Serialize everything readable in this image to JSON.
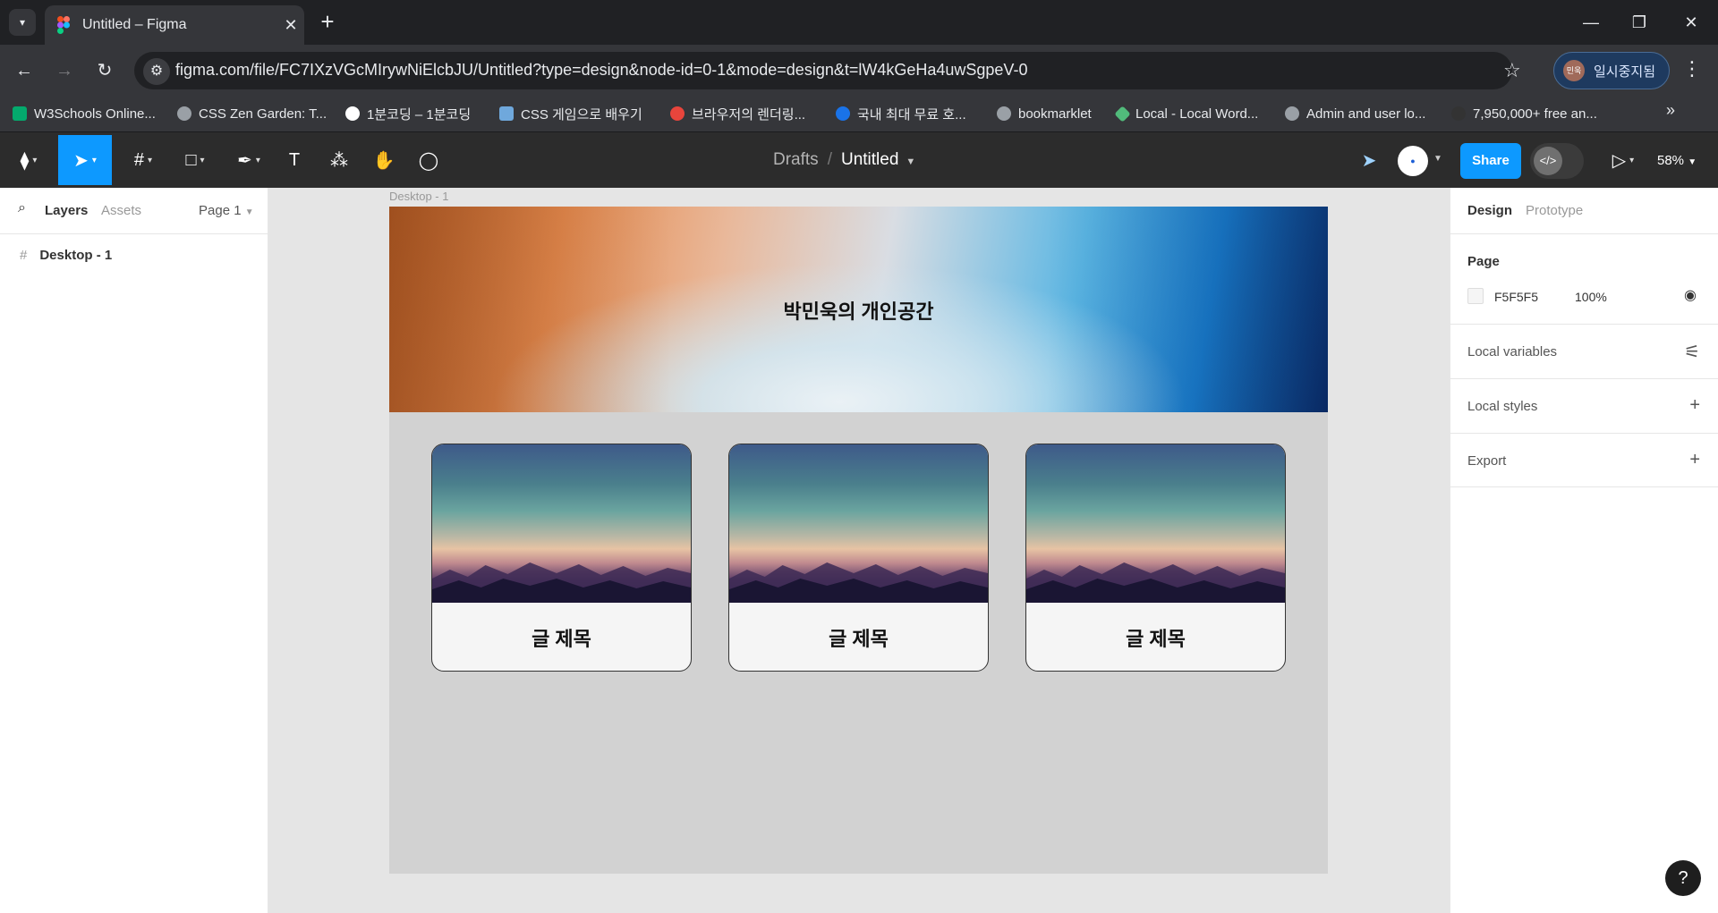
{
  "browser": {
    "tab_title": "Untitled – Figma",
    "new_tab": "+",
    "url": "figma.com/file/FC7IXzVGcMIrywNiElcbJU/Untitled?type=design&node-id=0-1&mode=design&t=lW4kGeHa4uwSgpeV-0",
    "profile_label": "일시중지됨",
    "profile_avatar": "민욱",
    "bookmarks": [
      {
        "label": "W3Schools Online...",
        "color": "#04aa6d"
      },
      {
        "label": "CSS Zen Garden: T...",
        "color": "#9aa0a6"
      },
      {
        "label": "1분코딩 – 1분코딩",
        "color": "#ffffff"
      },
      {
        "label": "CSS 게임으로 배우기",
        "color": "#6fa8dc"
      },
      {
        "label": "브라우저의 렌더링...",
        "color": "#e8453c"
      },
      {
        "label": "국내 최대 무료 호...",
        "color": "#1a73e8"
      },
      {
        "label": "bookmarklet",
        "color": "#9aa0a6"
      },
      {
        "label": "Local - Local Word...",
        "color": "#51bb7b"
      },
      {
        "label": "Admin and user lo...",
        "color": "#9aa0a6"
      },
      {
        "label": "7,950,000+ free an...",
        "color": "#333333"
      }
    ]
  },
  "figma": {
    "breadcrumb_drafts": "Drafts",
    "breadcrumb_sep": "/",
    "file_name": "Untitled",
    "share_label": "Share",
    "zoom": "58%",
    "left_panel": {
      "tab_layers": "Layers",
      "tab_assets": "Assets",
      "page_selector": "Page 1",
      "layers": [
        {
          "name": "Desktop - 1"
        }
      ]
    },
    "canvas": {
      "frame_label": "Desktop - 1",
      "hero_title": "박민욱의 개인공간",
      "cards": [
        {
          "title": "글 제목"
        },
        {
          "title": "글 제목"
        },
        {
          "title": "글 제목"
        }
      ]
    },
    "right_panel": {
      "tab_design": "Design",
      "tab_prototype": "Prototype",
      "page_heading": "Page",
      "page_color_hex": "F5F5F5",
      "page_opacity": "100%",
      "local_variables": "Local variables",
      "local_styles": "Local styles",
      "export": "Export"
    },
    "help": "?",
    "accent_color": "#0d99ff"
  }
}
